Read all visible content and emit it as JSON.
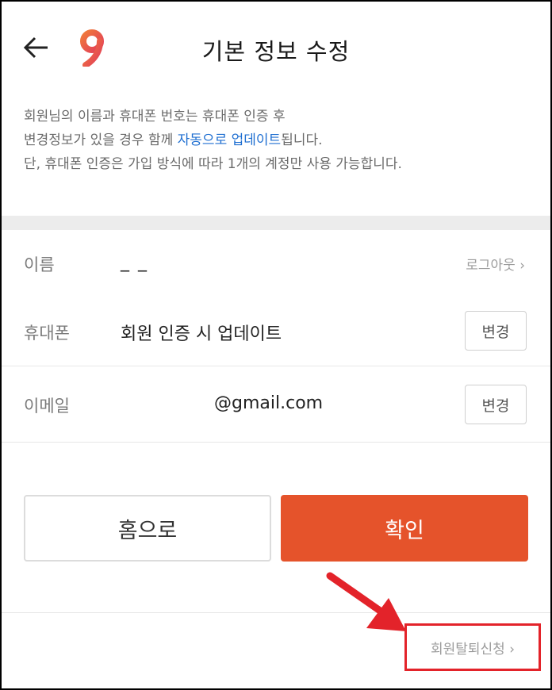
{
  "header": {
    "title": "기본 정보 수정",
    "back_icon": "arrow-left-icon",
    "logo_icon": "brand-logo"
  },
  "info": {
    "line1": "회원님의 이름과 휴대폰 번호는 휴대폰 인증 후",
    "line2_prefix": "변경정보가 있을 경우 함께 ",
    "line2_highlight": "자동으로 업데이트",
    "line2_suffix": "됩니다.",
    "line3": "단, 휴대폰 인증은 가입 방식에 따라 1개의 계정만 사용 가능합니다."
  },
  "fields": {
    "name_label": "이름",
    "name_value": "_ _",
    "logout_label": "로그아웃 ›",
    "phone_label": "휴대폰",
    "phone_value": "회원 인증 시 업데이트",
    "phone_change": "변경",
    "email_label": "이메일",
    "email_value": "@gmail.com",
    "email_change": "변경"
  },
  "buttons": {
    "home": "홈으로",
    "confirm": "확인"
  },
  "footer": {
    "withdraw": "회원탈퇴신청 ›"
  },
  "colors": {
    "accent": "#e5532b",
    "link": "#1f6fd1",
    "annotation": "#e3232a"
  }
}
